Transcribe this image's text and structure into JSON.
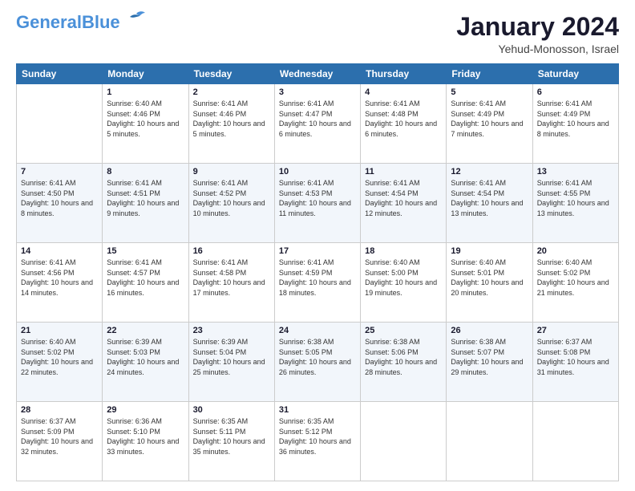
{
  "header": {
    "logo_line1": "General",
    "logo_line2": "Blue",
    "month": "January 2024",
    "location": "Yehud-Monosson, Israel"
  },
  "days_of_week": [
    "Sunday",
    "Monday",
    "Tuesday",
    "Wednesday",
    "Thursday",
    "Friday",
    "Saturday"
  ],
  "weeks": [
    [
      {
        "day": "",
        "sunrise": "",
        "sunset": "",
        "daylight": ""
      },
      {
        "day": "1",
        "sunrise": "Sunrise: 6:40 AM",
        "sunset": "Sunset: 4:46 PM",
        "daylight": "Daylight: 10 hours and 5 minutes."
      },
      {
        "day": "2",
        "sunrise": "Sunrise: 6:41 AM",
        "sunset": "Sunset: 4:46 PM",
        "daylight": "Daylight: 10 hours and 5 minutes."
      },
      {
        "day": "3",
        "sunrise": "Sunrise: 6:41 AM",
        "sunset": "Sunset: 4:47 PM",
        "daylight": "Daylight: 10 hours and 6 minutes."
      },
      {
        "day": "4",
        "sunrise": "Sunrise: 6:41 AM",
        "sunset": "Sunset: 4:48 PM",
        "daylight": "Daylight: 10 hours and 6 minutes."
      },
      {
        "day": "5",
        "sunrise": "Sunrise: 6:41 AM",
        "sunset": "Sunset: 4:49 PM",
        "daylight": "Daylight: 10 hours and 7 minutes."
      },
      {
        "day": "6",
        "sunrise": "Sunrise: 6:41 AM",
        "sunset": "Sunset: 4:49 PM",
        "daylight": "Daylight: 10 hours and 8 minutes."
      }
    ],
    [
      {
        "day": "7",
        "sunrise": "Sunrise: 6:41 AM",
        "sunset": "Sunset: 4:50 PM",
        "daylight": "Daylight: 10 hours and 8 minutes."
      },
      {
        "day": "8",
        "sunrise": "Sunrise: 6:41 AM",
        "sunset": "Sunset: 4:51 PM",
        "daylight": "Daylight: 10 hours and 9 minutes."
      },
      {
        "day": "9",
        "sunrise": "Sunrise: 6:41 AM",
        "sunset": "Sunset: 4:52 PM",
        "daylight": "Daylight: 10 hours and 10 minutes."
      },
      {
        "day": "10",
        "sunrise": "Sunrise: 6:41 AM",
        "sunset": "Sunset: 4:53 PM",
        "daylight": "Daylight: 10 hours and 11 minutes."
      },
      {
        "day": "11",
        "sunrise": "Sunrise: 6:41 AM",
        "sunset": "Sunset: 4:54 PM",
        "daylight": "Daylight: 10 hours and 12 minutes."
      },
      {
        "day": "12",
        "sunrise": "Sunrise: 6:41 AM",
        "sunset": "Sunset: 4:54 PM",
        "daylight": "Daylight: 10 hours and 13 minutes."
      },
      {
        "day": "13",
        "sunrise": "Sunrise: 6:41 AM",
        "sunset": "Sunset: 4:55 PM",
        "daylight": "Daylight: 10 hours and 13 minutes."
      }
    ],
    [
      {
        "day": "14",
        "sunrise": "Sunrise: 6:41 AM",
        "sunset": "Sunset: 4:56 PM",
        "daylight": "Daylight: 10 hours and 14 minutes."
      },
      {
        "day": "15",
        "sunrise": "Sunrise: 6:41 AM",
        "sunset": "Sunset: 4:57 PM",
        "daylight": "Daylight: 10 hours and 16 minutes."
      },
      {
        "day": "16",
        "sunrise": "Sunrise: 6:41 AM",
        "sunset": "Sunset: 4:58 PM",
        "daylight": "Daylight: 10 hours and 17 minutes."
      },
      {
        "day": "17",
        "sunrise": "Sunrise: 6:41 AM",
        "sunset": "Sunset: 4:59 PM",
        "daylight": "Daylight: 10 hours and 18 minutes."
      },
      {
        "day": "18",
        "sunrise": "Sunrise: 6:40 AM",
        "sunset": "Sunset: 5:00 PM",
        "daylight": "Daylight: 10 hours and 19 minutes."
      },
      {
        "day": "19",
        "sunrise": "Sunrise: 6:40 AM",
        "sunset": "Sunset: 5:01 PM",
        "daylight": "Daylight: 10 hours and 20 minutes."
      },
      {
        "day": "20",
        "sunrise": "Sunrise: 6:40 AM",
        "sunset": "Sunset: 5:02 PM",
        "daylight": "Daylight: 10 hours and 21 minutes."
      }
    ],
    [
      {
        "day": "21",
        "sunrise": "Sunrise: 6:40 AM",
        "sunset": "Sunset: 5:02 PM",
        "daylight": "Daylight: 10 hours and 22 minutes."
      },
      {
        "day": "22",
        "sunrise": "Sunrise: 6:39 AM",
        "sunset": "Sunset: 5:03 PM",
        "daylight": "Daylight: 10 hours and 24 minutes."
      },
      {
        "day": "23",
        "sunrise": "Sunrise: 6:39 AM",
        "sunset": "Sunset: 5:04 PM",
        "daylight": "Daylight: 10 hours and 25 minutes."
      },
      {
        "day": "24",
        "sunrise": "Sunrise: 6:38 AM",
        "sunset": "Sunset: 5:05 PM",
        "daylight": "Daylight: 10 hours and 26 minutes."
      },
      {
        "day": "25",
        "sunrise": "Sunrise: 6:38 AM",
        "sunset": "Sunset: 5:06 PM",
        "daylight": "Daylight: 10 hours and 28 minutes."
      },
      {
        "day": "26",
        "sunrise": "Sunrise: 6:38 AM",
        "sunset": "Sunset: 5:07 PM",
        "daylight": "Daylight: 10 hours and 29 minutes."
      },
      {
        "day": "27",
        "sunrise": "Sunrise: 6:37 AM",
        "sunset": "Sunset: 5:08 PM",
        "daylight": "Daylight: 10 hours and 31 minutes."
      }
    ],
    [
      {
        "day": "28",
        "sunrise": "Sunrise: 6:37 AM",
        "sunset": "Sunset: 5:09 PM",
        "daylight": "Daylight: 10 hours and 32 minutes."
      },
      {
        "day": "29",
        "sunrise": "Sunrise: 6:36 AM",
        "sunset": "Sunset: 5:10 PM",
        "daylight": "Daylight: 10 hours and 33 minutes."
      },
      {
        "day": "30",
        "sunrise": "Sunrise: 6:35 AM",
        "sunset": "Sunset: 5:11 PM",
        "daylight": "Daylight: 10 hours and 35 minutes."
      },
      {
        "day": "31",
        "sunrise": "Sunrise: 6:35 AM",
        "sunset": "Sunset: 5:12 PM",
        "daylight": "Daylight: 10 hours and 36 minutes."
      },
      {
        "day": "",
        "sunrise": "",
        "sunset": "",
        "daylight": ""
      },
      {
        "day": "",
        "sunrise": "",
        "sunset": "",
        "daylight": ""
      },
      {
        "day": "",
        "sunrise": "",
        "sunset": "",
        "daylight": ""
      }
    ]
  ]
}
